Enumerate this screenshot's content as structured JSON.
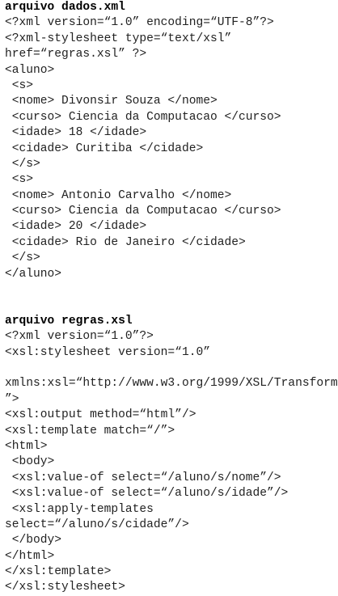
{
  "sections": [
    {
      "heading": "arquivo dados.xml",
      "lines": [
        "<?xml version=“1.0” encoding=“UTF-8”?>",
        "<?xml-stylesheet type=“text/xsl”",
        "href=“regras.xsl” ?>",
        "<aluno>",
        " <s>",
        " <nome> Divonsir Souza </nome>",
        " <curso> Ciencia da Computacao </curso>",
        " <idade> 18 </idade>",
        " <cidade> Curitiba </cidade>",
        " </s>",
        " <s>",
        " <nome> Antonio Carvalho </nome>",
        " <curso> Ciencia da Computacao </curso>",
        " <idade> 20 </idade>",
        " <cidade> Rio de Janeiro </cidade>",
        " </s>",
        "</aluno>"
      ]
    },
    {
      "heading": "arquivo regras.xsl",
      "lines": [
        "<?xml version=“1.0”?>",
        "<xsl:stylesheet version=“1.0”",
        "",
        "xmlns:xsl=“http://www.w3.org/1999/XSL/Transform",
        "”>",
        "<xsl:output method=“html”/>",
        "<xsl:template match=“/”>",
        "<html>",
        " <body>",
        " <xsl:value-of select=“/aluno/s/nome”/>",
        " <xsl:value-of select=“/aluno/s/idade”/>",
        " <xsl:apply-templates",
        "select=“/aluno/s/cidade”/>",
        " </body>",
        "</html>",
        "</xsl:template>",
        "</xsl:stylesheet>"
      ]
    }
  ]
}
